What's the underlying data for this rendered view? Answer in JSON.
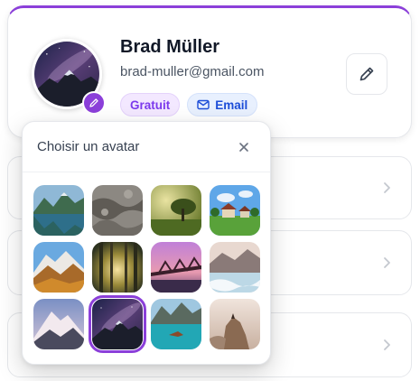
{
  "profile": {
    "name": "Brad Müller",
    "email": "brad-muller@gmail.com",
    "plan_badge": "Gratuit",
    "email_badge": "Email"
  },
  "avatar_picker": {
    "title": "Choisir un avatar",
    "selected_index": 9,
    "avatars": [
      {
        "id": "lake-mountains"
      },
      {
        "id": "rock-texture"
      },
      {
        "id": "lone-tree"
      },
      {
        "id": "countryside-houses"
      },
      {
        "id": "autumn-mountains"
      },
      {
        "id": "sunlit-forest"
      },
      {
        "id": "bridge-sunset"
      },
      {
        "id": "glacier-river"
      },
      {
        "id": "snowy-peak"
      },
      {
        "id": "milky-way-mountain"
      },
      {
        "id": "turquoise-lake"
      },
      {
        "id": "canyon-cliff"
      }
    ]
  },
  "colors": {
    "accent": "#8b3fd9",
    "plan_badge_bg": "#f3e8ff",
    "email_badge_bg": "#e8f0fe"
  }
}
